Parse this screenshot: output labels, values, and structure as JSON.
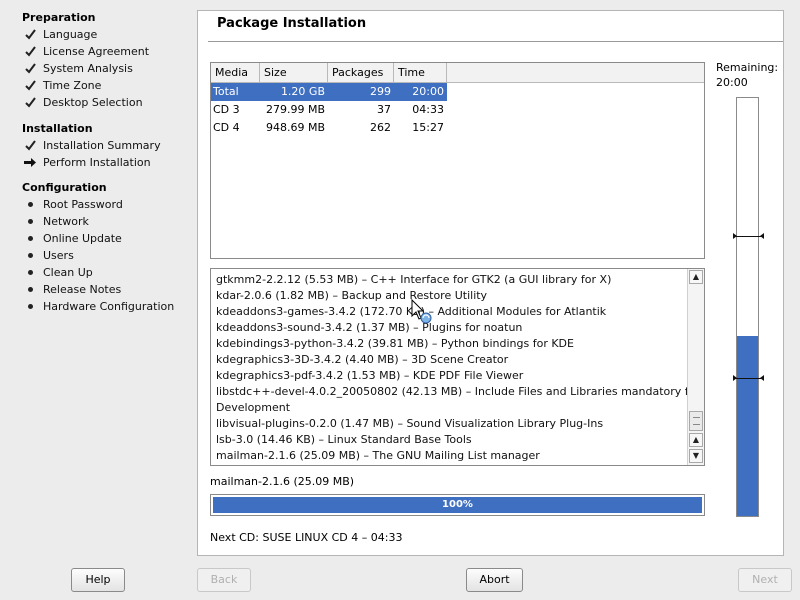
{
  "sidebar": {
    "sections": [
      {
        "title": "Preparation",
        "steps": [
          {
            "label": "Language",
            "status": "done"
          },
          {
            "label": "License Agreement",
            "status": "done"
          },
          {
            "label": "System Analysis",
            "status": "done"
          },
          {
            "label": "Time Zone",
            "status": "done"
          },
          {
            "label": "Desktop Selection",
            "status": "done"
          }
        ]
      },
      {
        "title": "Installation",
        "steps": [
          {
            "label": "Installation Summary",
            "status": "done"
          },
          {
            "label": "Perform Installation",
            "status": "current"
          }
        ]
      },
      {
        "title": "Configuration",
        "steps": [
          {
            "label": "Root Password",
            "status": "pending"
          },
          {
            "label": "Network",
            "status": "pending"
          },
          {
            "label": "Online Update",
            "status": "pending"
          },
          {
            "label": "Users",
            "status": "pending"
          },
          {
            "label": "Clean Up",
            "status": "pending"
          },
          {
            "label": "Release Notes",
            "status": "pending"
          },
          {
            "label": "Hardware Configuration",
            "status": "pending"
          }
        ]
      }
    ]
  },
  "main": {
    "title": "Package Installation",
    "media_table": {
      "columns": [
        "Media",
        "Size",
        "Packages",
        "Time"
      ],
      "rows": [
        {
          "media": "Total",
          "size": "1.20 GB",
          "packages": "299",
          "time": "20:00",
          "selected": true
        },
        {
          "media": "CD 3",
          "size": "279.99 MB",
          "packages": "37",
          "time": "04:33",
          "selected": false
        },
        {
          "media": "CD 4",
          "size": "948.69 MB",
          "packages": "262",
          "time": "15:27",
          "selected": false
        }
      ]
    },
    "package_log": [
      "gtkmm2-2.2.12 (5.53 MB) – C++ Interface for GTK2 (a GUI library for X)",
      "kdar-2.0.6 (1.82 MB) – Backup and Restore Utility",
      "kdeaddons3-games-3.4.2 (172.70 KB) – Additional Modules for Atlantik",
      "kdeaddons3-sound-3.4.2 (1.37 MB) – Plugins for noatun",
      "kdebindings3-python-3.4.2 (39.81 MB) – Python bindings for KDE",
      "kdegraphics3-3D-3.4.2 (4.40 MB) – 3D Scene Creator",
      "kdegraphics3-pdf-3.4.2 (1.53 MB) – KDE PDF File Viewer",
      "libstdc++-devel-4.0.2_20050802 (42.13 MB) – Include Files and Libraries mandatory for",
      "Development",
      "libvisual-plugins-0.2.0 (1.47 MB) – Sound Visualization Library Plug-Ins",
      "lsb-3.0 (14.46 KB) – Linux Standard Base Tools",
      "mailman-2.1.6 (25.09 MB) – The GNU Mailing List manager"
    ],
    "current_package": "mailman-2.1.6 (25.09 MB)",
    "progress_percent": 100,
    "progress_label": "100%",
    "next_cd": "Next CD: SUSE LINUX CD 4 – 04:33"
  },
  "remaining": {
    "label": "Remaining:",
    "time": "20:00",
    "fill_fraction": 0.43,
    "marker_fractions": [
      0.67,
      0.33
    ]
  },
  "buttons": {
    "help": "Help",
    "back": "Back",
    "abort": "Abort",
    "next": "Next"
  },
  "colors": {
    "accent": "#3f6fc0",
    "panel_border": "#b5b5b5"
  }
}
